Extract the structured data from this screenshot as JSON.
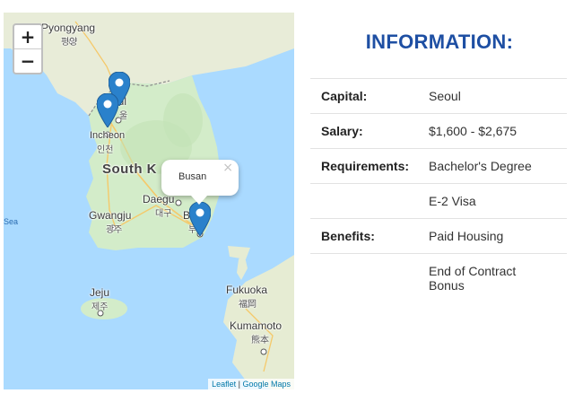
{
  "map": {
    "zoom_in": "+",
    "zoom_out": "−",
    "labels": {
      "pyongyang": "Pyongyang",
      "pyongyang_ko": "평양",
      "seoul_partial": "oul",
      "seoul_ko_partial": "울",
      "incheon": "Incheon",
      "incheon_ko": "인천",
      "south_korea": "South K",
      "daegu": "Daegu",
      "daegu_ko": "대구",
      "gwangju": "Gwangju",
      "gwangju_ko": "광주",
      "busan_partial": "B",
      "busan_ko_partial": "부",
      "jeju": "Jeju",
      "jeju_ko": "제주",
      "fukuoka": "Fukuoka",
      "fukuoka_ja": "福岡",
      "kumamoto": "Kumamoto",
      "kumamoto_ja": "熊本",
      "sea": "Sea"
    },
    "popup": {
      "text": "Busan",
      "close": "×"
    },
    "attribution": {
      "leaflet": "Leaflet",
      "separator": " | ",
      "google": "Google Maps"
    }
  },
  "info": {
    "title": "INFORMATION:",
    "rows": [
      {
        "key": "Capital:",
        "value": "Seoul"
      },
      {
        "key": "Salary:",
        "value": "$1,600 - $2,675"
      },
      {
        "key": "Requirements:",
        "value": "Bachelor's Degree"
      },
      {
        "key": "",
        "value": "E-2 Visa"
      },
      {
        "key": "Benefits:",
        "value": "Paid Housing"
      },
      {
        "key": "",
        "value": "End of Contract Bonus"
      }
    ]
  },
  "colors": {
    "sea": "#aadaff",
    "land": "#d9efd2",
    "title": "#1e4fa3",
    "marker": "#2a81cb"
  }
}
